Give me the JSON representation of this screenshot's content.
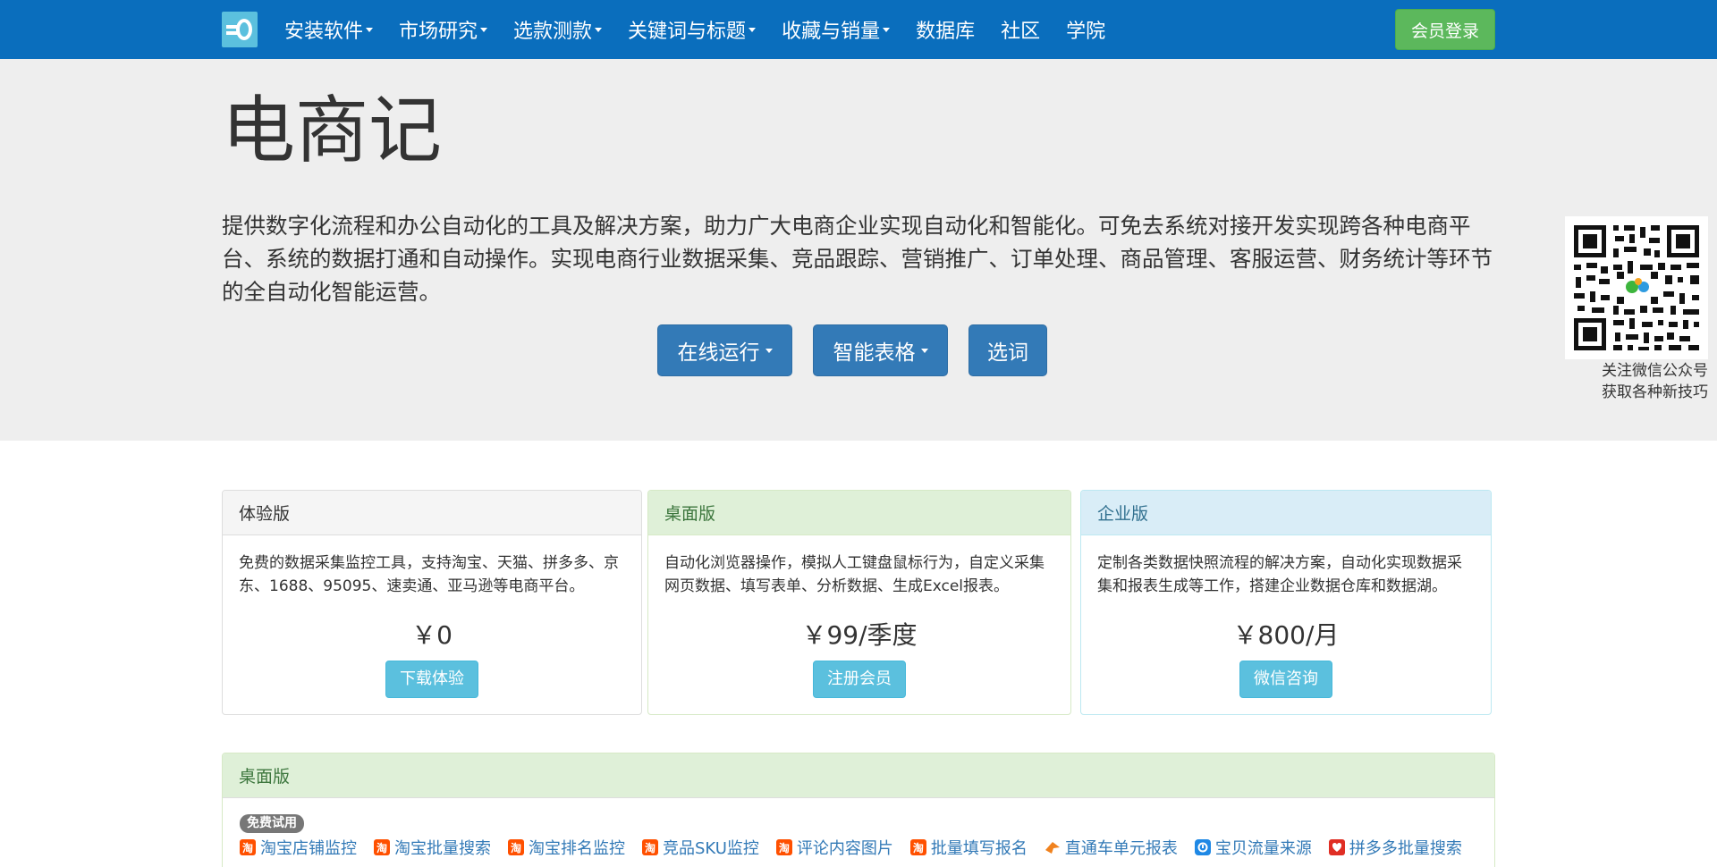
{
  "nav": {
    "items": [
      {
        "label": "安装软件",
        "dropdown": true
      },
      {
        "label": "市场研究",
        "dropdown": true
      },
      {
        "label": "选款测款",
        "dropdown": true
      },
      {
        "label": "关键词与标题",
        "dropdown": true
      },
      {
        "label": "收藏与销量",
        "dropdown": true
      },
      {
        "label": "数据库",
        "dropdown": false
      },
      {
        "label": "社区",
        "dropdown": false
      },
      {
        "label": "学院",
        "dropdown": false
      }
    ],
    "login_label": "会员登录"
  },
  "hero": {
    "title": "电商记",
    "description": "提供数字化流程和办公自动化的工具及解决方案，助力广大电商企业实现自动化和智能化。可免去系统对接开发实现跨各种电商平台、系统的数据打通和自动操作。实现电商行业数据采集、竞品跟踪、营销推广、订单处理、商品管理、客服运营、财务统计等环节的全自动化智能运营。",
    "buttons": [
      {
        "label": "在线运行",
        "dropdown": true
      },
      {
        "label": "智能表格",
        "dropdown": true
      },
      {
        "label": "选词",
        "dropdown": false
      }
    ],
    "qr_caption_line1": "关注微信公众号",
    "qr_caption_line2": "获取各种新技巧"
  },
  "plans": [
    {
      "title": "体验版",
      "description": "免费的数据采集监控工具，支持淘宝、天猫、拼多多、京东、1688、95095、速卖通、亚马逊等电商平台。",
      "price": "￥0",
      "button": "下载体验"
    },
    {
      "title": "桌面版",
      "description": "自动化浏览器操作，模拟人工键盘鼠标行为，自定义采集网页数据、填写表单、分析数据、生成Excel报表。",
      "price": "￥99/季度",
      "button": "注册会员"
    },
    {
      "title": "企业版",
      "description": "定制各类数据快照流程的解决方案，自动化实现数据采集和报表生成等工作，搭建企业数据仓库和数据湖。",
      "price": "￥800/月",
      "button": "微信咨询"
    }
  ],
  "desktop_section": {
    "title": "桌面版",
    "badge": "免费试用",
    "tools": [
      {
        "label": "淘宝店铺监控",
        "icon": "taobao-icon",
        "glyph": "淘"
      },
      {
        "label": "淘宝批量搜索",
        "icon": "taobao-icon",
        "glyph": "淘"
      },
      {
        "label": "淘宝排名监控",
        "icon": "taobao-icon",
        "glyph": "淘"
      },
      {
        "label": "竞品SKU监控",
        "icon": "taobao-icon",
        "glyph": "淘"
      },
      {
        "label": "评论内容图片",
        "icon": "taobao-icon",
        "glyph": "淘"
      },
      {
        "label": "批量填写报名",
        "icon": "taobao-icon",
        "glyph": "淘"
      },
      {
        "label": "直通车单元报表",
        "icon": "ztc-icon",
        "glyph": ""
      },
      {
        "label": "宝贝流量来源",
        "icon": "shengyicanmou-icon",
        "glyph": ""
      },
      {
        "label": "拼多多批量搜索",
        "icon": "pinduoduo-icon",
        "glyph": ""
      }
    ]
  },
  "colors": {
    "navbar": "#0a6ebd",
    "login": "#5cb85c",
    "hero_bg": "#eeeeee",
    "primary": "#337ab7",
    "info": "#5bc0de",
    "success_bg": "#dff0d8",
    "info_bg": "#d9edf7"
  }
}
